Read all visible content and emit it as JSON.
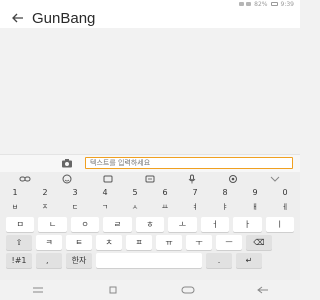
{
  "status_bar": {
    "battery_text": "82%",
    "time": "9:39"
  },
  "app_bar": {
    "back_icon": "arrow-left-icon",
    "title": "GunBang"
  },
  "input": {
    "placeholder": "텍스트를 입력하세요"
  },
  "keyboard": {
    "toolbar_icons": [
      "link-icon",
      "emoji-icon",
      "sticker-icon",
      "gif-icon",
      "mic-icon",
      "settings-icon",
      "chevron-down-icon"
    ],
    "numbers": [
      "1",
      "2",
      "3",
      "4",
      "5",
      "6",
      "7",
      "8",
      "9",
      "0"
    ],
    "row_1": [
      "ㅂ",
      "ㅈ",
      "ㄷ",
      "ㄱ",
      "ㅅ",
      "ㅛ",
      "ㅕ",
      "ㅑ",
      "ㅐ",
      "ㅔ"
    ],
    "row_2": [
      "ㅁ",
      "ㄴ",
      "ㅇ",
      "ㄹ",
      "ㅎ",
      "ㅗ",
      "ㅓ",
      "ㅏ",
      "ㅣ"
    ],
    "shift_label": "⇧",
    "row_3": [
      "ㅋ",
      "ㅌ",
      "ㅊ",
      "ㅍ",
      "ㅠ",
      "ㅜ",
      "ㅡ"
    ],
    "backspace_label": "⌫",
    "symbols_label": "!#1",
    "lang_label": "한자",
    "space_label": "",
    "period_label": ".",
    "enter_label": "↵"
  },
  "nav_bar": {
    "icons": [
      "menu-icon",
      "recent-apps-icon",
      "home-icon",
      "back-nav-icon"
    ]
  }
}
